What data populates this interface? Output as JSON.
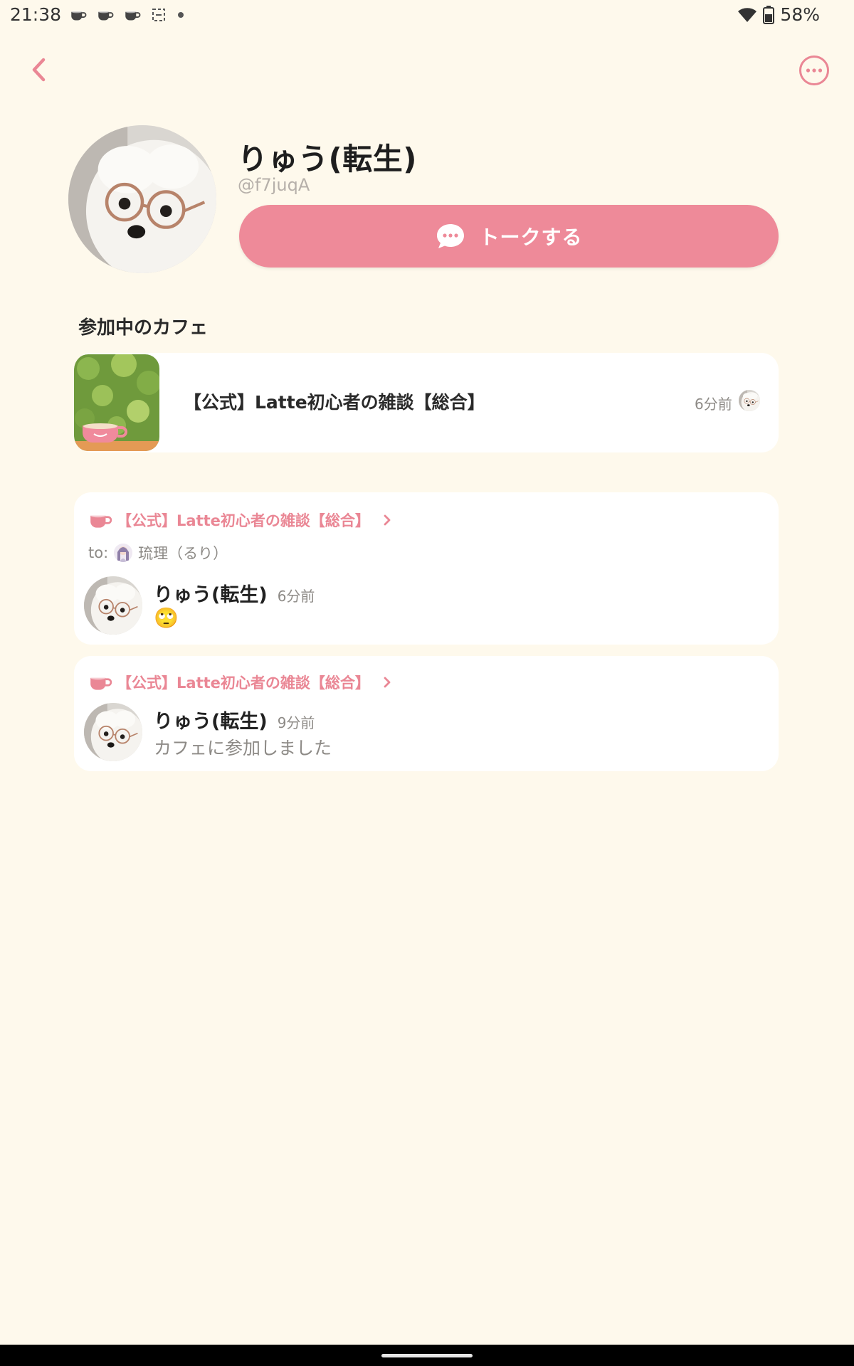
{
  "status_bar": {
    "time": "21:38",
    "battery": "58%",
    "notification_icons": [
      "cup-icon",
      "cup-icon",
      "cup-icon",
      "sync-icon",
      "dot-icon"
    ]
  },
  "nav": {
    "back_icon": "chevron-left-icon",
    "more_icon": "more-horizontal-icon"
  },
  "profile": {
    "name": "りゅう(転生)",
    "handle": "@f7juqA",
    "talk_button_label": "トークする"
  },
  "cafes_section": {
    "title": "参加中のカフェ",
    "items": [
      {
        "name": "【公式】Latte初心者の雑談【総合】",
        "time": "6分前"
      }
    ]
  },
  "activity": [
    {
      "cafe": "【公式】Latte初心者の雑談【総合】",
      "to_label": "to:",
      "to_name": "琉理（るり）",
      "author": "りゅう(転生)",
      "time": "6分前",
      "body": "🙄"
    },
    {
      "cafe": "【公式】Latte初心者の雑談【総合】",
      "author": "りゅう(転生)",
      "time": "9分前",
      "body": "カフェに参加しました"
    }
  ],
  "colors": {
    "background": "#fef9ec",
    "accent": "#ee8a99",
    "link": "#ea8795",
    "muted": "#8d8a86"
  }
}
